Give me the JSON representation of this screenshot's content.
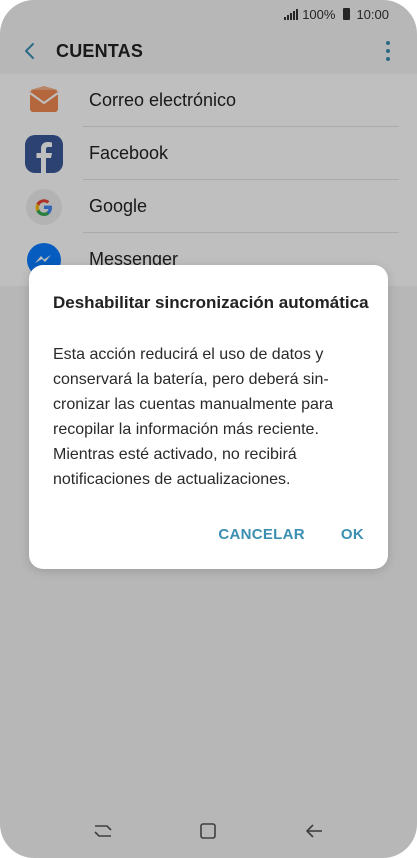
{
  "status_bar": {
    "battery_percent": "100%",
    "time": "10:00"
  },
  "header": {
    "title": "CUENTAS"
  },
  "accounts": [
    {
      "label": "Correo electrónico",
      "icon": "email-icon"
    },
    {
      "label": "Facebook",
      "icon": "facebook-icon"
    },
    {
      "label": "Google",
      "icon": "google-icon"
    },
    {
      "label": "Messenger",
      "icon": "messenger-icon"
    }
  ],
  "dialog": {
    "title": "Deshabilitar sincronización automática",
    "body": "Esta acción reducirá el uso de datos y conservará la batería, pero deberá sin-cronizar las cuentas manualmente para recopilar la información más reciente. Mientras esté activado, no recibirá notificaciones de actualizaciones.",
    "cancel_label": "CANCELAR",
    "ok_label": "OK"
  },
  "colors": {
    "accent": "#3b8fb2",
    "overlay": "rgba(0,0,0,0.25)"
  }
}
